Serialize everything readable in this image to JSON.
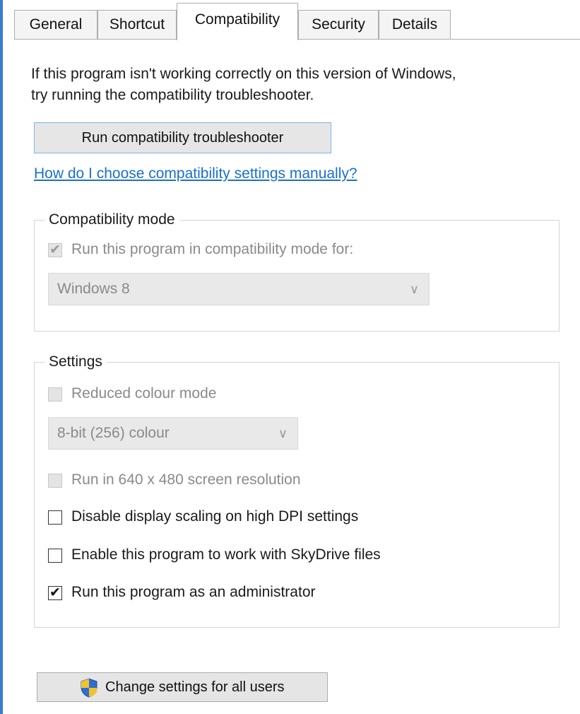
{
  "tabs": [
    {
      "label": "General",
      "active": false
    },
    {
      "label": "Shortcut",
      "active": false
    },
    {
      "label": "Compatibility",
      "active": true
    },
    {
      "label": "Security",
      "active": false
    },
    {
      "label": "Details",
      "active": false
    }
  ],
  "description": {
    "line1": "If this program isn't working correctly on this version of Windows,",
    "line2": "try running the compatibility troubleshooter."
  },
  "troubleshoot_button": "Run compatibility troubleshooter",
  "help_link": "How do I choose compatibility settings manually?",
  "compat_mode": {
    "legend": "Compatibility mode",
    "checkbox_label": "Run this program in compatibility mode for:",
    "checked": true,
    "selected_os": "Windows 8"
  },
  "settings": {
    "legend": "Settings",
    "reduced_colour": {
      "label": "Reduced colour mode",
      "checked": false,
      "enabled": false
    },
    "colour_depth": "8-bit (256) colour",
    "res_640": {
      "label": "Run in 640 x 480 screen resolution",
      "checked": false,
      "enabled": false
    },
    "dpi": {
      "label": "Disable display scaling on high DPI settings",
      "checked": false,
      "enabled": true
    },
    "skydrive": {
      "label": "Enable this program to work with SkyDrive files",
      "checked": false,
      "enabled": true
    },
    "admin": {
      "label": "Run this program as an administrator",
      "checked": true,
      "enabled": true
    }
  },
  "all_users_button": "Change settings for all users",
  "colors": {
    "link": "#1a6fd0",
    "focus_border": "#7eb4ea",
    "window_edge": "#3a7bd5"
  }
}
